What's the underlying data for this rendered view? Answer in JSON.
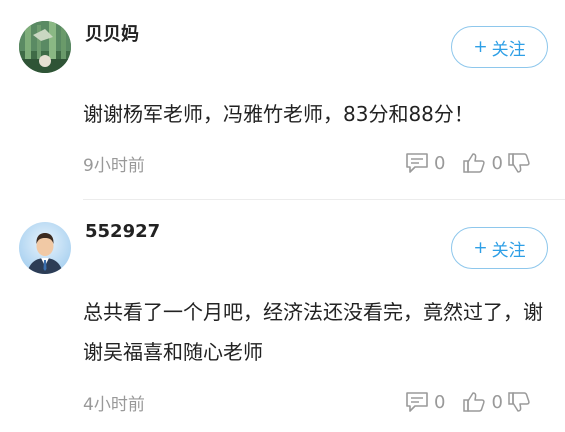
{
  "comments": [
    {
      "username": "贝贝妈",
      "follow_label": "关注",
      "follow_plus": "+",
      "text": "谢谢杨军老师，冯雅竹老师，83分和88分！",
      "time": "9小时前",
      "reply_count": "0",
      "like_count": "0",
      "avatar_icon": "bamboo-avatar-icon"
    },
    {
      "username": "552927",
      "follow_label": "关注",
      "follow_plus": "+",
      "text": "总共看了一个月吧，经济法还没看完，竟然过了，谢谢吴福喜和随心老师",
      "time": "4小时前",
      "reply_count": "0",
      "like_count": "0",
      "avatar_icon": "businessman-avatar-icon"
    }
  ],
  "colors": {
    "accent": "#2e9fe6",
    "meta": "#999999",
    "text": "#222222"
  }
}
